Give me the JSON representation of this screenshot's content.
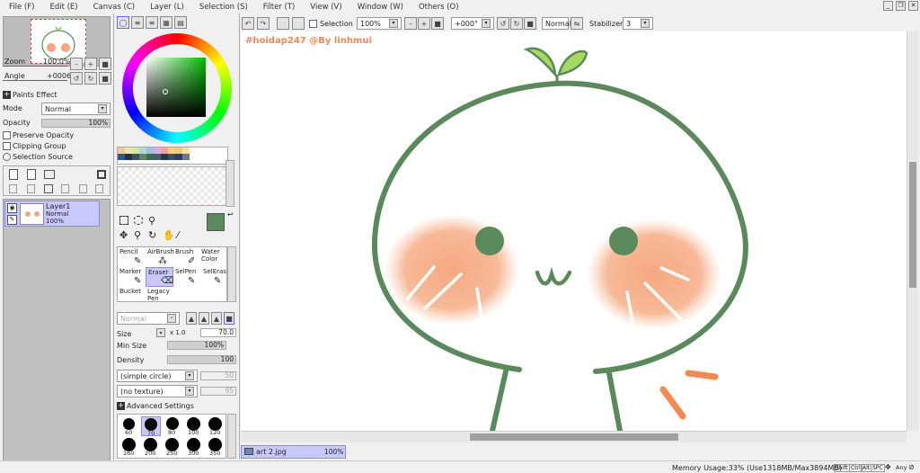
{
  "menu": [
    "File (F)",
    "Edit (E)",
    "Canvas (C)",
    "Layer (L)",
    "Selection (S)",
    "Filter (T)",
    "View (V)",
    "Window (W)",
    "Others (O)"
  ],
  "nav": {
    "zoom_label": "Zoom",
    "zoom_value": "100.0%",
    "angle_label": "Angle",
    "angle_value": "+0006"
  },
  "paints_effect": {
    "title": "Paints Effect",
    "mode_label": "Mode",
    "mode_value": "Normal",
    "opacity_label": "Opacity",
    "opacity_value": "100%",
    "preserve_opacity": "Preserve Opacity",
    "clipping_group": "Clipping Group",
    "selection_source": "Selection Source"
  },
  "layer": {
    "name": "Layer1",
    "mode": "Normal",
    "opacity": "100%"
  },
  "toolbar": {
    "selection_label": "Selection",
    "zoom_value": "100%",
    "angle_value": "+000°",
    "blend_value": "Normal",
    "stabilizer_label": "Stabilizer",
    "stabilizer_value": "3"
  },
  "canvas": {
    "watermark": "#hoidap247 @By linhmui"
  },
  "tools": {
    "row1": [
      "Pencil",
      "AirBrush",
      "Brush",
      "Water Color"
    ],
    "row2": [
      "Marker",
      "Eraser",
      "SelPen",
      "SelEras"
    ],
    "row3": [
      "Bucket",
      "Legacy Pen"
    ]
  },
  "brush": {
    "blend_value": "Normal",
    "size_label": "Size",
    "size_mult": "x 1.0",
    "size_value": "70.0",
    "min_size_label": "Min Size",
    "min_size_value": "100%",
    "density_label": "Density",
    "density_value": "100",
    "shape_value": "(simple circle)",
    "shape_num": "50",
    "texture_value": "(no texture)",
    "texture_num": "95",
    "advanced": "Advanced Settings",
    "sizes_row1": [
      "60",
      "70",
      "80",
      "100",
      "120"
    ],
    "sizes_row2": [
      "160",
      "200",
      "250",
      "300",
      "350"
    ]
  },
  "status": {
    "file_name": "art 2.jpg",
    "file_zoom": "100%",
    "memory": "Memory Usage:33% (Use1318MB/Max3894MB)",
    "keys": [
      "Shift",
      "Ctrl",
      "Alt",
      "SPC"
    ],
    "any": "Any"
  },
  "colors": {
    "brush_green": "#5a8a5c",
    "blush": "#f5a880",
    "accent": "#8a8aee",
    "watermark": "#f08858"
  }
}
